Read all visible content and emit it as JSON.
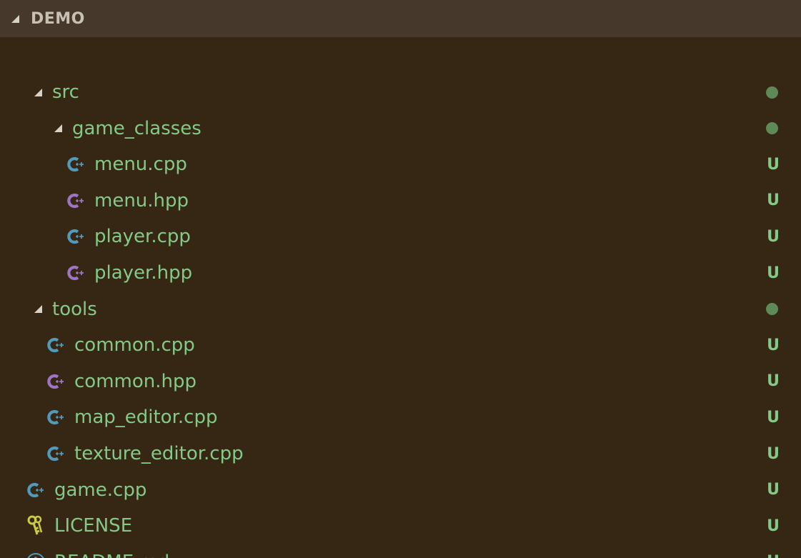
{
  "explorer": {
    "title": "DEMO",
    "items": [
      {
        "kind": "folder",
        "label": "src",
        "depth": 1,
        "status": "dot",
        "icon": "chevron-down-icon"
      },
      {
        "kind": "folder",
        "label": "game_classes",
        "depth": 2,
        "status": "dot",
        "icon": "chevron-down-icon"
      },
      {
        "kind": "file",
        "label": "menu.cpp",
        "depth": 3,
        "status": "U",
        "icon": "cpp-file-icon"
      },
      {
        "kind": "file",
        "label": "menu.hpp",
        "depth": 3,
        "status": "U",
        "icon": "hpp-file-icon"
      },
      {
        "kind": "file",
        "label": "player.cpp",
        "depth": 3,
        "status": "U",
        "icon": "cpp-file-icon"
      },
      {
        "kind": "file",
        "label": "player.hpp",
        "depth": 3,
        "status": "U",
        "icon": "hpp-file-icon"
      },
      {
        "kind": "folder",
        "label": "tools",
        "depth": 1,
        "status": "dot",
        "icon": "chevron-down-icon"
      },
      {
        "kind": "file",
        "label": "common.cpp",
        "depth": 2,
        "status": "U",
        "icon": "cpp-file-icon"
      },
      {
        "kind": "file",
        "label": "common.hpp",
        "depth": 2,
        "status": "U",
        "icon": "hpp-file-icon"
      },
      {
        "kind": "file",
        "label": "map_editor.cpp",
        "depth": 2,
        "status": "U",
        "icon": "cpp-file-icon"
      },
      {
        "kind": "file",
        "label": "texture_editor.cpp",
        "depth": 2,
        "status": "U",
        "icon": "cpp-file-icon"
      },
      {
        "kind": "file",
        "label": "game.cpp",
        "depth": 1,
        "status": "U",
        "icon": "cpp-file-icon"
      },
      {
        "kind": "file",
        "label": "LICENSE",
        "depth": 1,
        "status": "U",
        "icon": "key-icon"
      },
      {
        "kind": "file",
        "label": "README.md",
        "depth": 1,
        "status": "U",
        "icon": "info-icon"
      }
    ]
  },
  "colors": {
    "background": "#352714",
    "header_background": "#46382a",
    "header_text": "#c8c0b2",
    "label": "#84c987",
    "status_untracked": "#84c987",
    "status_dot": "#5e8a57",
    "cpp_icon": "#519aba",
    "hpp_icon": "#a074c4",
    "license_icon": "#cbcb41",
    "info_icon": "#519aba",
    "twisty": "#d8d2c6"
  }
}
